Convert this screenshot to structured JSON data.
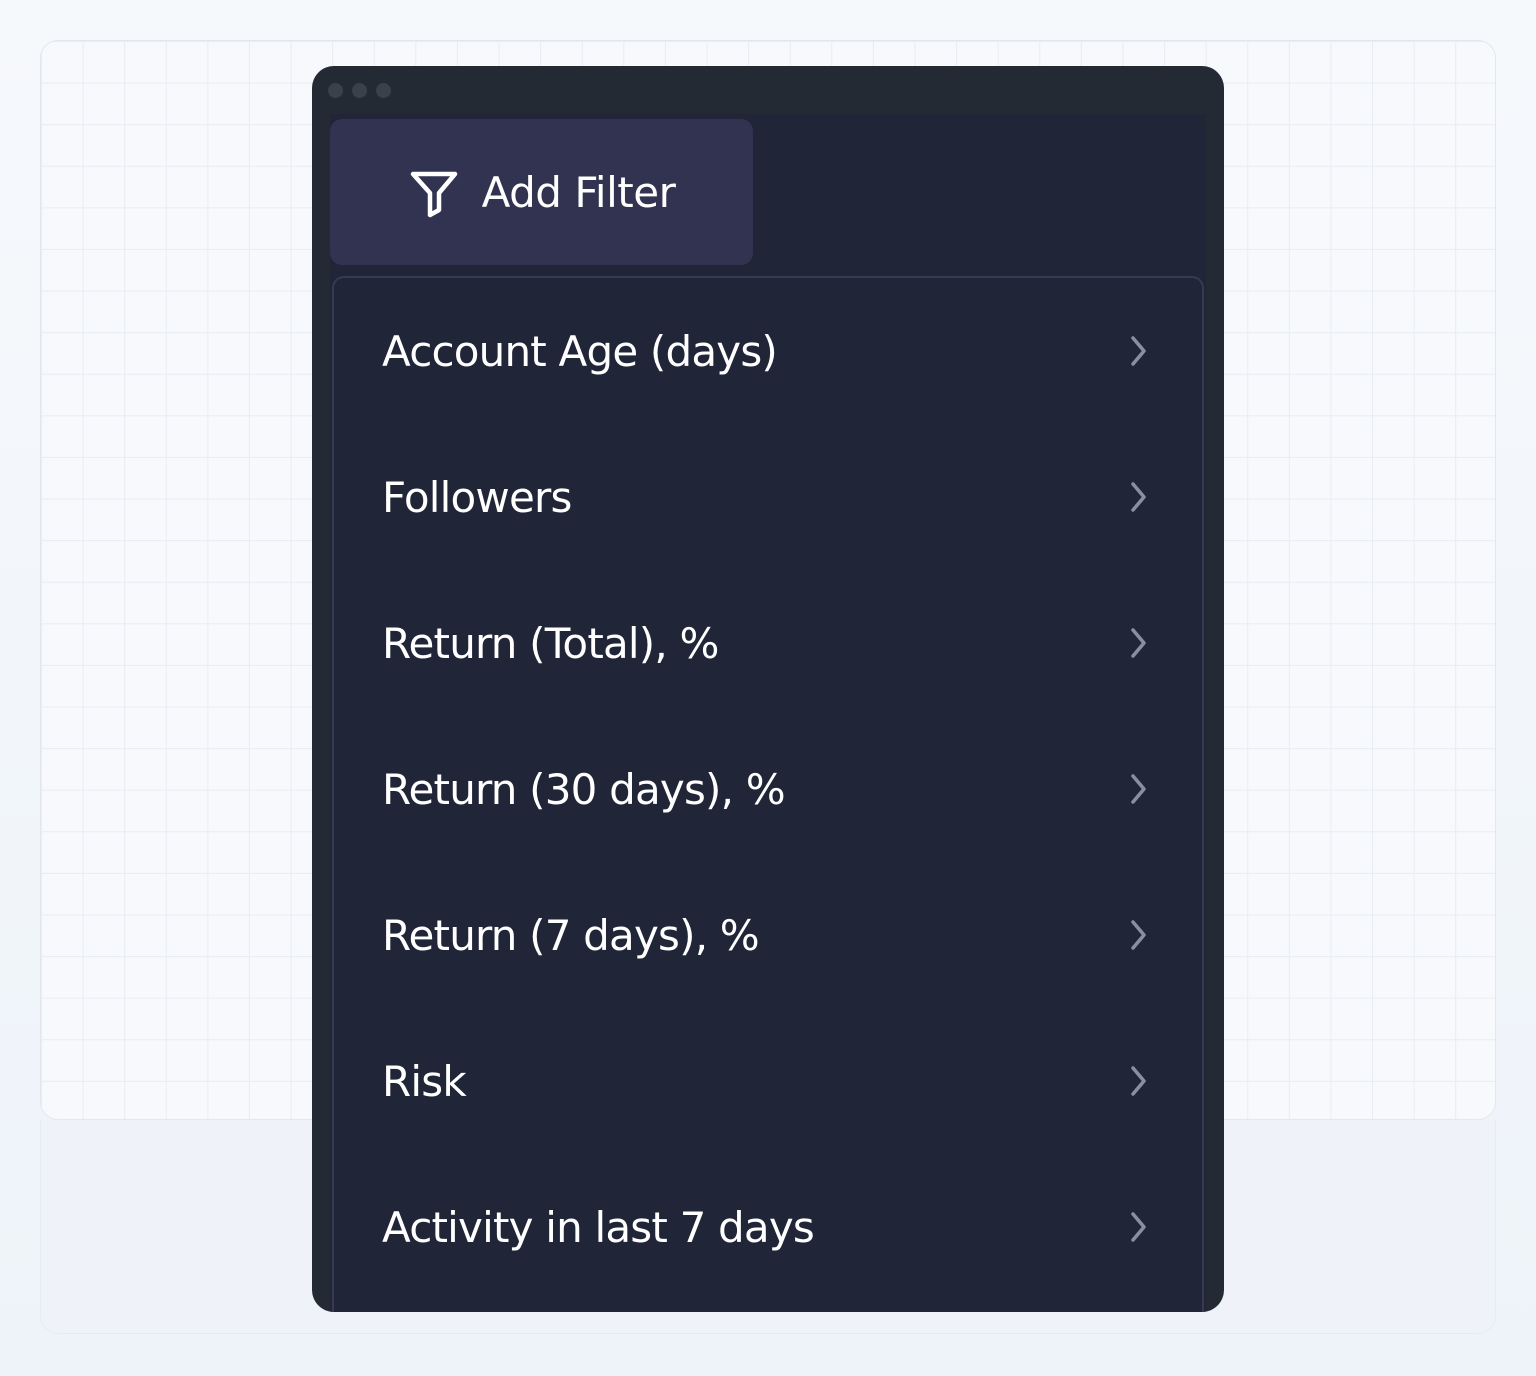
{
  "filter_panel": {
    "add_filter_label": "Add Filter",
    "add_filter_icon": "funnel-icon",
    "chevron_icon": "chevron-right-icon",
    "items": [
      {
        "label": "Account Age (days)"
      },
      {
        "label": "Followers"
      },
      {
        "label": "Return (Total), %"
      },
      {
        "label": "Return (30 days), %"
      },
      {
        "label": "Return (7 days), %"
      },
      {
        "label": "Risk"
      },
      {
        "label": "Activity in last 7 days"
      }
    ]
  },
  "colors": {
    "window_bg": "#242a33",
    "content_bg": "#212538",
    "button_bg": "#313350",
    "text": "#ffffff",
    "chevron": "#8a8f9f"
  }
}
